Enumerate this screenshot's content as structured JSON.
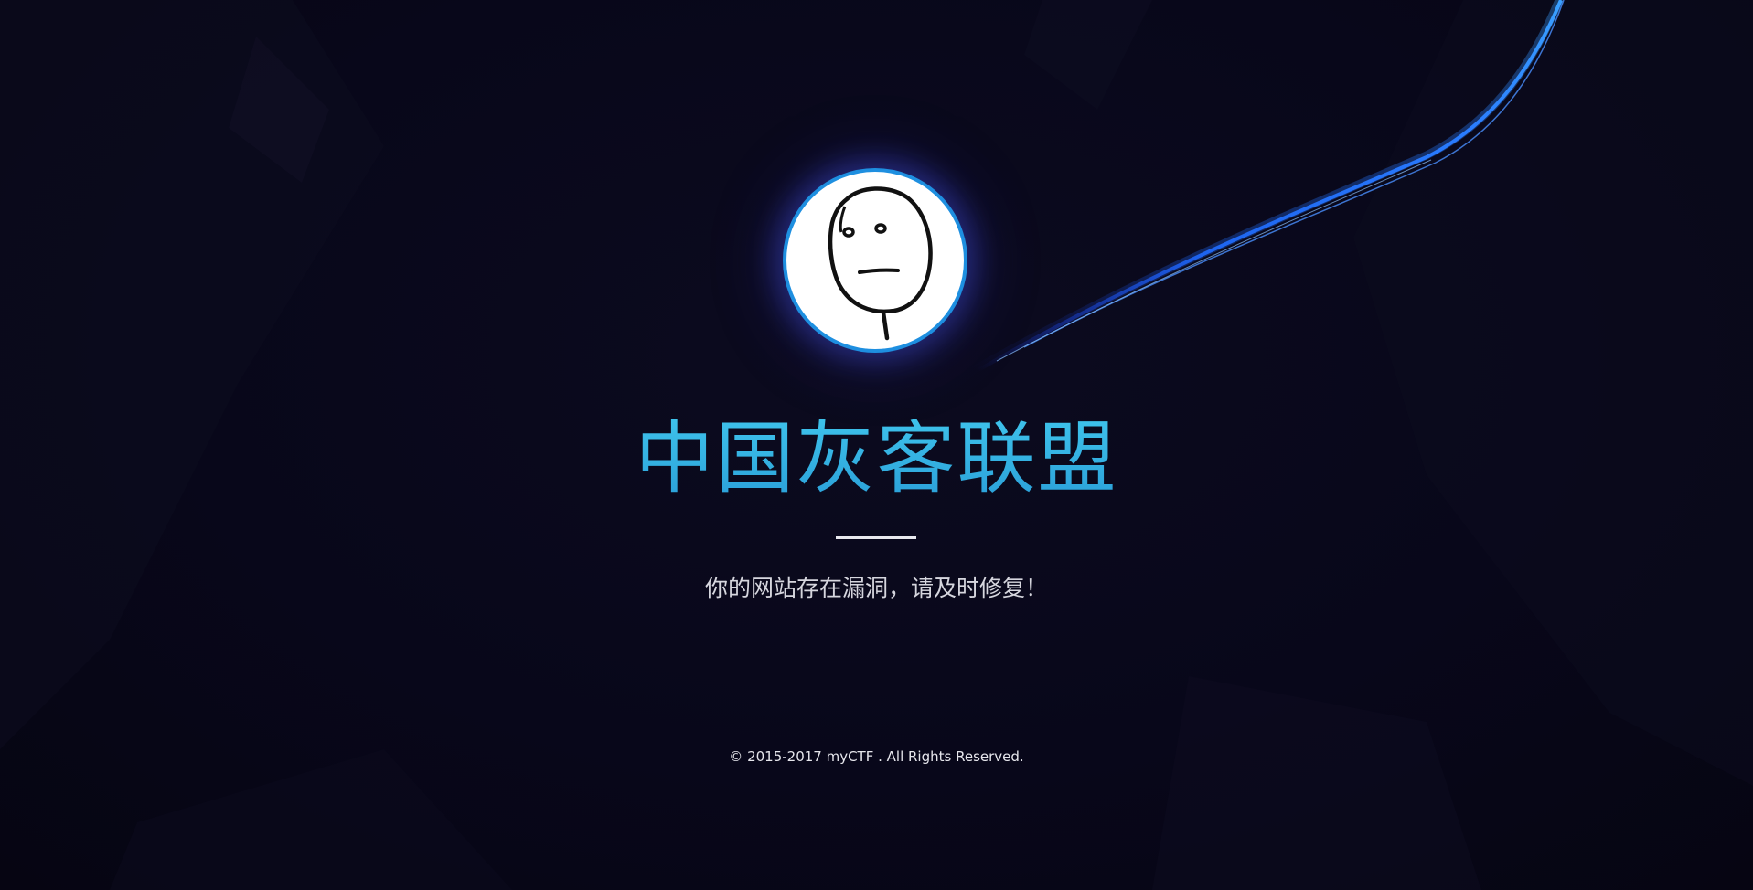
{
  "header": {
    "title": "中国灰客联盟"
  },
  "main": {
    "message": "你的网站存在漏洞，请及时修复！",
    "avatar_icon": "rage-face-icon"
  },
  "footer": {
    "copyright": "© 2015-2017 myCTF . All Rights Reserved."
  },
  "colors": {
    "background": "#090817",
    "title": "#2fb0e0",
    "avatar_border": "#1e8fe0",
    "light_streak": "#1f6bff"
  }
}
